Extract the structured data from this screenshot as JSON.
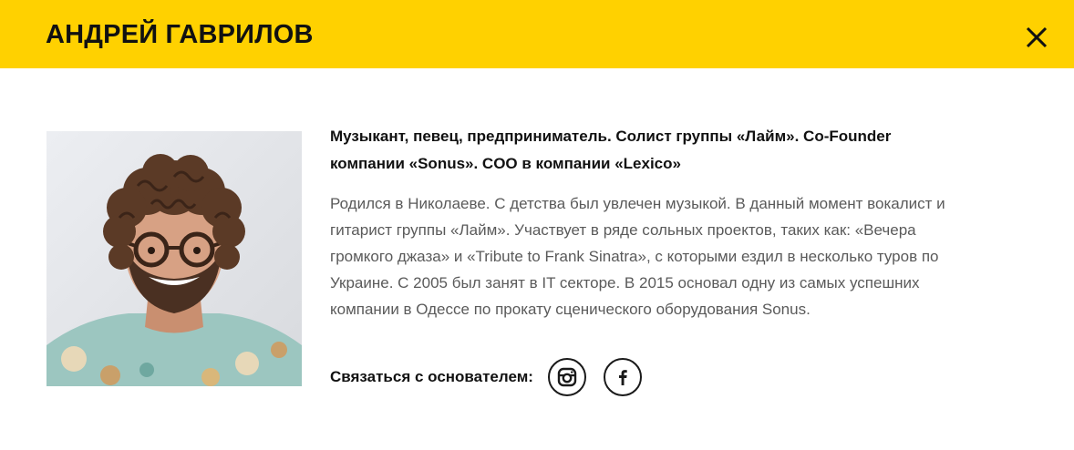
{
  "modal": {
    "title": "АНДРЕЙ ГАВРИЛОВ",
    "accent_color": "#FFD100"
  },
  "profile": {
    "photo_alt": "avatar-photo",
    "role": "Музыкант, певец, предприниматель. Солист группы «Лайм». Co-Founder компании «Sonus». COO в компании «Lexico»",
    "bio": "Родился в Николаеве. С детства был увлечен музыкой. В данный момент вокалист и гитарист группы «Лайм». Участвует в ряде сольных проектов, таких как: «Вечера громкого джаза» и «Tribute to Frank Sinatra», с которыми ездил в несколько туров по Украине. С 2005 был занят в IT секторе. В 2015 основал одну из самых успешних компании в Одессе по прокату сценического оборудования Sonus.",
    "contact_label": "Связаться с основателем:",
    "social": [
      {
        "icon": "instagram-icon"
      },
      {
        "icon": "facebook-icon"
      }
    ]
  }
}
